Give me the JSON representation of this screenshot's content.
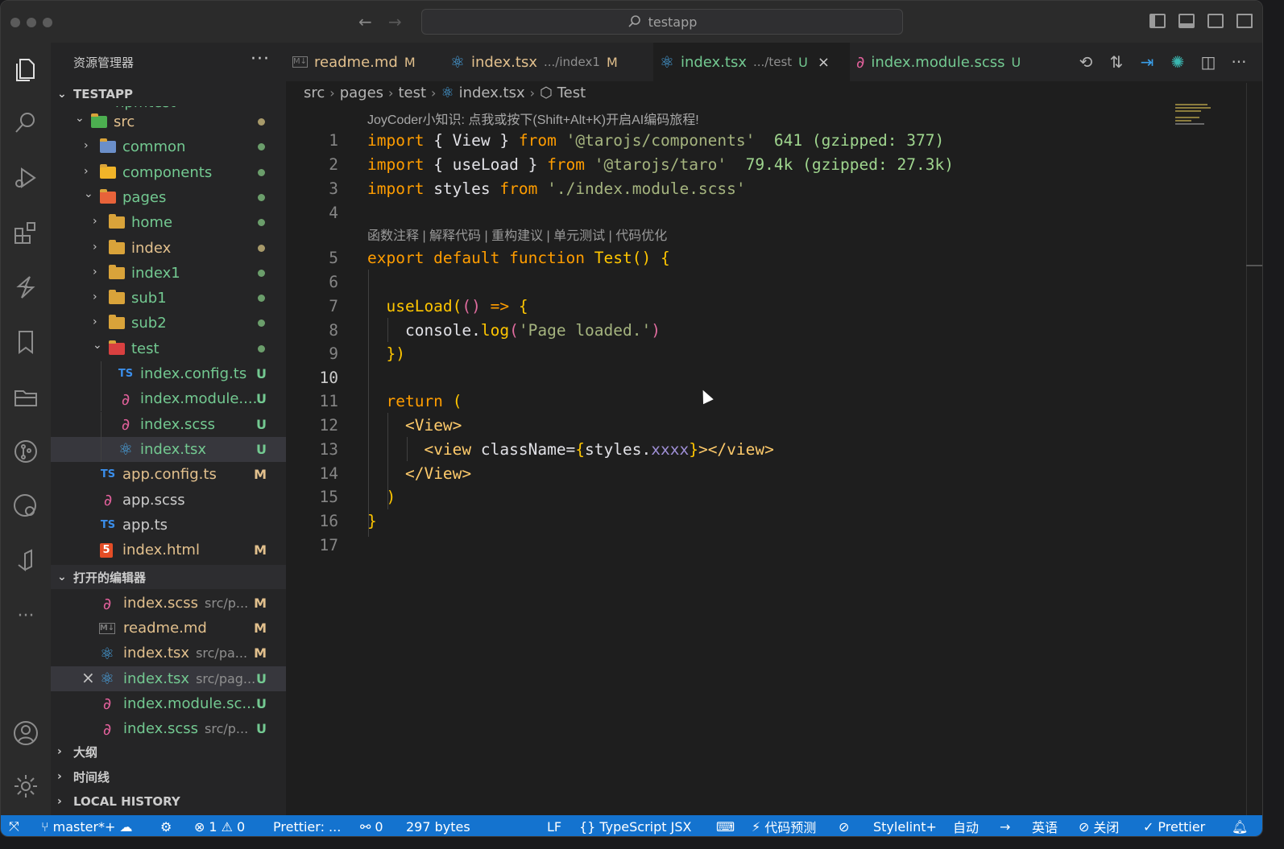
{
  "titlebar": {
    "search_text": "testapp"
  },
  "sidebar": {
    "title": "资源管理器",
    "more": "···",
    "project_title": "TESTAPP",
    "partial_item": "npmtest",
    "tree": [
      {
        "label": "src",
        "indent": 0,
        "expanded": true,
        "kind": "folder-src",
        "marker": "dot-olive"
      },
      {
        "label": "common",
        "indent": 1,
        "expanded": false,
        "kind": "folder-common",
        "marker": "dot-green"
      },
      {
        "label": "components",
        "indent": 1,
        "expanded": false,
        "kind": "folder-components",
        "marker": "dot-green"
      },
      {
        "label": "pages",
        "indent": 1,
        "expanded": true,
        "kind": "folder-pages",
        "marker": "dot-green"
      },
      {
        "label": "home",
        "indent": 2,
        "expanded": false,
        "kind": "folder",
        "marker": "dot-green"
      },
      {
        "label": "index",
        "indent": 2,
        "expanded": false,
        "kind": "folder",
        "marker": "dot-olive"
      },
      {
        "label": "index1",
        "indent": 2,
        "expanded": false,
        "kind": "folder",
        "marker": "dot-green"
      },
      {
        "label": "sub1",
        "indent": 2,
        "expanded": false,
        "kind": "folder",
        "marker": "dot-green"
      },
      {
        "label": "sub2",
        "indent": 2,
        "expanded": false,
        "kind": "folder",
        "marker": "dot-green"
      },
      {
        "label": "test",
        "indent": 2,
        "expanded": true,
        "kind": "folder-test",
        "marker": "dot-green"
      },
      {
        "label": "index.config.ts",
        "indent": 3,
        "kind": "ts",
        "badge": "U"
      },
      {
        "label": "index.module....",
        "indent": 3,
        "kind": "sass",
        "badge": "U"
      },
      {
        "label": "index.scss",
        "indent": 3,
        "kind": "sass",
        "badge": "U"
      },
      {
        "label": "index.tsx",
        "indent": 3,
        "kind": "react",
        "badge": "U",
        "selected": true
      },
      {
        "label": "app.config.ts",
        "indent": 1,
        "kind": "ts",
        "badge": "M"
      },
      {
        "label": "app.scss",
        "indent": 1,
        "kind": "sass",
        "badge": ""
      },
      {
        "label": "app.ts",
        "indent": 1,
        "kind": "ts",
        "badge": ""
      },
      {
        "label": "index.html",
        "indent": 1,
        "kind": "html",
        "badge": "M"
      }
    ],
    "open_editors_title": "打开的编辑器",
    "open_editors": [
      {
        "label": "index.scss",
        "desc": "src/p...",
        "kind": "sass",
        "badge": "M"
      },
      {
        "label": "readme.md",
        "desc": "",
        "kind": "md",
        "badge": "M"
      },
      {
        "label": "index.tsx",
        "desc": "src/pa...",
        "kind": "react",
        "badge": "M"
      },
      {
        "label": "index.tsx",
        "desc": "src/pag...",
        "kind": "react",
        "badge": "U",
        "selected": true,
        "close": "×"
      },
      {
        "label": "index.module.sc...",
        "desc": "",
        "kind": "sass",
        "badge": "U"
      },
      {
        "label": "index.scss",
        "desc": "src/p...",
        "kind": "sass",
        "badge": "U"
      }
    ],
    "outline_title": "大纲",
    "timeline_title": "时间线",
    "local_history_title": "LOCAL HISTORY"
  },
  "tabs": [
    {
      "label": "readme.md",
      "sub": "",
      "badge": "M",
      "kind": "md"
    },
    {
      "label": "index.tsx",
      "sub": ".../index1",
      "badge": "M",
      "kind": "react"
    },
    {
      "label": "index.tsx",
      "sub": ".../test",
      "badge": "U",
      "kind": "react",
      "active": true,
      "close": "×"
    },
    {
      "label": "index.module.scss",
      "sub": "",
      "badge": "U",
      "kind": "sass"
    }
  ],
  "breadcrumb": [
    "src",
    "pages",
    "test",
    "index.tsx",
    "Test"
  ],
  "editor": {
    "ai_tip": "JoyCoder小知识: 点我或按下(Shift+Alt+K)开启AI编码旅程!",
    "codelens": "函数注释 | 解释代码 | 重构建议 | 单元测试 | 代码优化",
    "current_line": "10",
    "lines": [
      {
        "n": "1",
        "tokens": [
          [
            "kw",
            "import"
          ],
          [
            "tx",
            " { View } "
          ],
          [
            "kw",
            "from"
          ],
          [
            "tx",
            " "
          ],
          [
            "str",
            "'@tarojs/components'"
          ],
          [
            "hint",
            "  641 (gzipped: 377)"
          ]
        ]
      },
      {
        "n": "2",
        "tokens": [
          [
            "kw",
            "import"
          ],
          [
            "tx",
            " { useLoad } "
          ],
          [
            "kw",
            "from"
          ],
          [
            "tx",
            " "
          ],
          [
            "str",
            "'@tarojs/taro'"
          ],
          [
            "hint",
            "  79.4k (gzipped: 27.3k)"
          ]
        ]
      },
      {
        "n": "3",
        "tokens": [
          [
            "kw",
            "import"
          ],
          [
            "tx",
            " styles "
          ],
          [
            "kw",
            "from"
          ],
          [
            "tx",
            " "
          ],
          [
            "str",
            "'./index.module.scss'"
          ]
        ]
      },
      {
        "n": "4",
        "tokens": []
      },
      {
        "n": "5",
        "tokens": [
          [
            "kw",
            "export default function"
          ],
          [
            "tx",
            " "
          ],
          [
            "fn",
            "Test"
          ],
          [
            "fn",
            "()"
          ],
          [
            "tx",
            " "
          ],
          [
            "fn",
            "{"
          ]
        ]
      },
      {
        "n": "6",
        "tokens": []
      },
      {
        "n": "7",
        "tokens": [
          [
            "tx",
            "  "
          ],
          [
            "fn",
            "useLoad"
          ],
          [
            "fn",
            "("
          ],
          [
            "pnk",
            "()"
          ],
          [
            "tx",
            " "
          ],
          [
            "kw",
            "=>"
          ],
          [
            "tx",
            " "
          ],
          [
            "fn",
            "{"
          ]
        ]
      },
      {
        "n": "8",
        "tokens": [
          [
            "tx",
            "    console."
          ],
          [
            "fn",
            "log"
          ],
          [
            "pnk",
            "("
          ],
          [
            "str",
            "'Page loaded.'"
          ],
          [
            "pnk",
            ")"
          ]
        ]
      },
      {
        "n": "9",
        "tokens": [
          [
            "tx",
            "  "
          ],
          [
            "fn",
            "})"
          ]
        ]
      },
      {
        "n": "10",
        "tokens": []
      },
      {
        "n": "11",
        "tokens": [
          [
            "tx",
            "  "
          ],
          [
            "kw",
            "return"
          ],
          [
            "tx",
            " "
          ],
          [
            "fn",
            "("
          ]
        ]
      },
      {
        "n": "12",
        "tokens": [
          [
            "tx",
            "    "
          ],
          [
            "tag",
            "<View>"
          ]
        ]
      },
      {
        "n": "13",
        "tokens": [
          [
            "tx",
            "      "
          ],
          [
            "tag",
            "<view"
          ],
          [
            "tx",
            " className="
          ],
          [
            "fn",
            "{"
          ],
          [
            "tx",
            "styles."
          ],
          [
            "prop",
            "xxxx"
          ],
          [
            "fn",
            "}"
          ],
          [
            "tag",
            "></view>"
          ]
        ]
      },
      {
        "n": "14",
        "tokens": [
          [
            "tx",
            "    "
          ],
          [
            "tag",
            "</View>"
          ]
        ]
      },
      {
        "n": "15",
        "tokens": [
          [
            "tx",
            "  "
          ],
          [
            "fn",
            ")"
          ]
        ]
      },
      {
        "n": "16",
        "tokens": [
          [
            "fn",
            "}"
          ]
        ]
      },
      {
        "n": "17",
        "tokens": []
      }
    ]
  },
  "statusbar": {
    "branch": "master*+",
    "errors": "1",
    "warnings": "0",
    "prettier_left": "Prettier: ...",
    "ports": "0",
    "size": "297 bytes",
    "eol": "LF",
    "language": "TypeScript JSX",
    "prediction": "代码预测",
    "stylelint": "Stylelint+",
    "auto": "自动",
    "lang_en": "英语",
    "close": "关闭",
    "prettier": "Prettier"
  },
  "colors": {
    "accent": "#1473cf",
    "untracked": "#73c991",
    "modified": "#e2c08d"
  }
}
